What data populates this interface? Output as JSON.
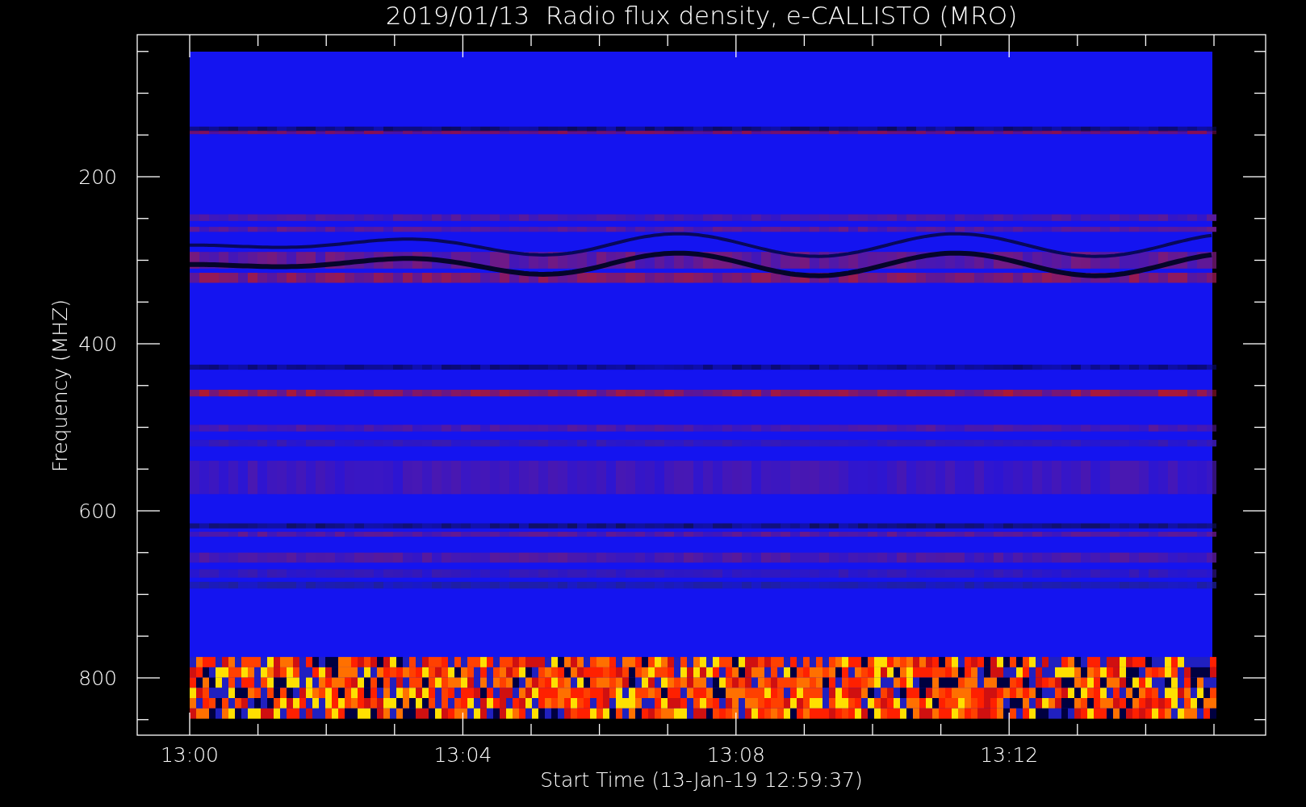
{
  "chart": {
    "title": "2019/01/13  Radio flux density, e-CALLISTO (MRO)",
    "ylabel": "Frequency (MHZ)",
    "xlabel": "Start Time (13-Jan-19 12:59:37)",
    "yticks": [
      "200",
      "400",
      "600",
      "800"
    ],
    "xticks": [
      "13:00",
      "13:04",
      "13:08",
      "13:12"
    ]
  }
}
